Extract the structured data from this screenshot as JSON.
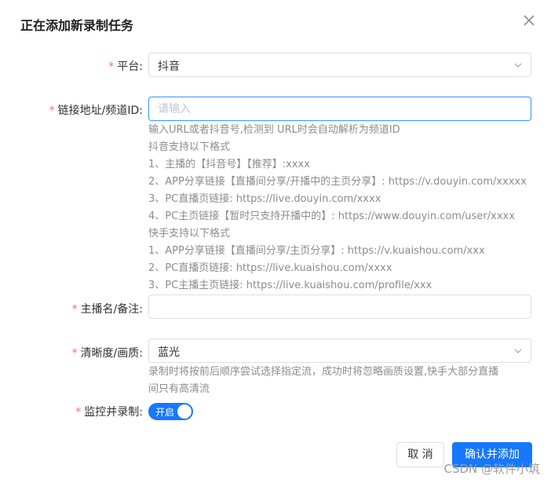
{
  "dialog": {
    "title": "正在添加新录制任务",
    "close_icon": "close-icon"
  },
  "fields": {
    "platform": {
      "required_mark": "*",
      "label": "平台:",
      "value": "抖音",
      "icon": "chevron-down-icon"
    },
    "link": {
      "required_mark": "*",
      "label": "链接地址/频道ID:",
      "value": "",
      "placeholder": "请输入"
    },
    "anchor_name": {
      "required_mark": "*",
      "label": "主播名/备注:",
      "value": "",
      "placeholder": ""
    },
    "quality": {
      "required_mark": "*",
      "label": "清晰度/画质:",
      "value": "蓝光",
      "icon": "chevron-down-icon"
    },
    "monitor": {
      "required_mark": "*",
      "label": "监控并录制:",
      "switch_text": "开启",
      "switch_on": true
    }
  },
  "help": {
    "link_lines": [
      "输入URL或者抖音号,检测到 URL时会自动解析为频道ID",
      "抖音支持以下格式",
      "1、主播的【抖音号】【推荐】:xxxx",
      "2、APP分享链接【直播间分享/开播中的主页分享】: https://v.douyin.com/xxxxx",
      "3、PC直播页链接: https://live.douyin.com/xxxx",
      "4、PC主页链接【暂时只支持开播中的】: https://www.douyin.com/user/xxxx",
      "快手支持以下格式",
      "1、APP分享链接【直播间分享/主页分享】: https://v.kuaishou.com/xxx",
      "2、PC直播页链接: https://live.kuaishou.com/xxxx",
      "3、PC主播主页链接: https://live.kuaishou.com/profile/xxx"
    ],
    "quality_lines": [
      "录制时将按前后顺序尝试选择指定流，成功时将忽略画质设置,快手大部分直播",
      "间只有高清流"
    ]
  },
  "buttons": {
    "cancel": "取 消",
    "confirm": "确认并添加"
  },
  "watermark": "CSDN @软件小筑",
  "colors": {
    "primary": "#1677ff",
    "required": "#f56c6c",
    "help_text": "#8c8c8c",
    "focus_border": "#409eff"
  }
}
